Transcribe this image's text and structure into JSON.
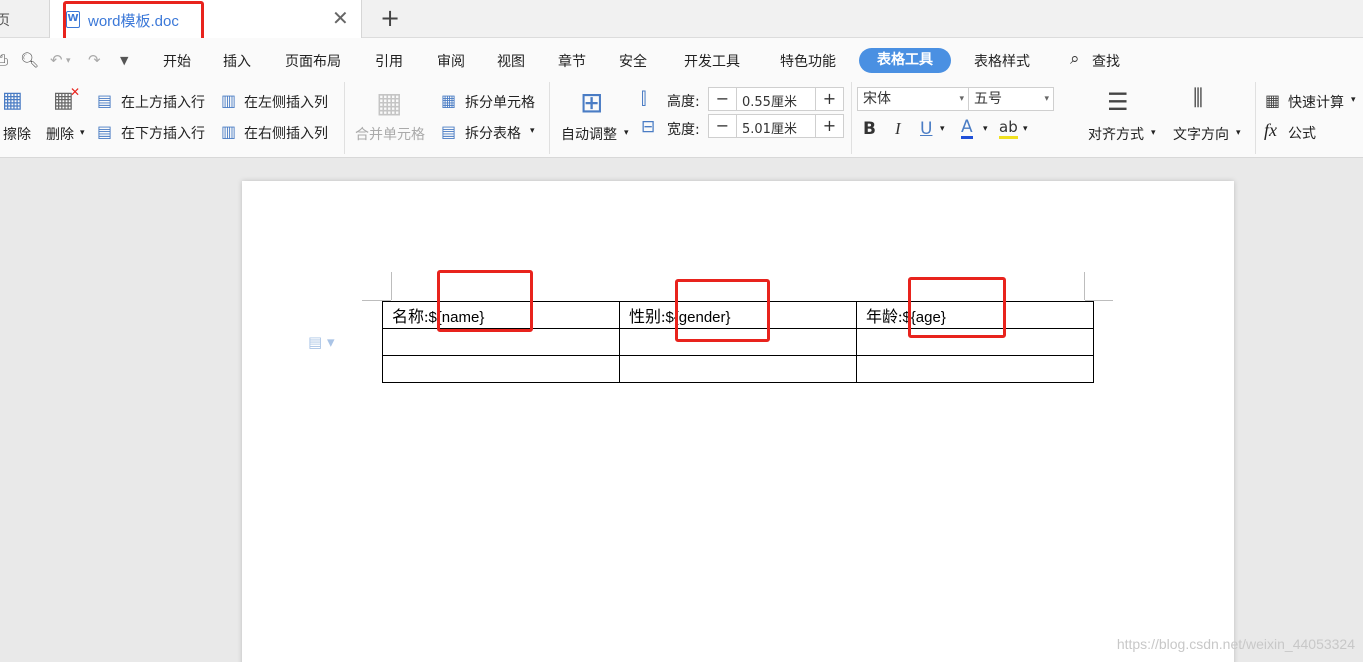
{
  "tabs": {
    "home_partial": "页",
    "active_title": "word模板.doc",
    "doc_icon": "W",
    "close": "✕",
    "new": "+"
  },
  "menu": {
    "items": [
      "开始",
      "插入",
      "页面布局",
      "引用",
      "审阅",
      "视图",
      "章节",
      "安全",
      "开发工具",
      "特色功能",
      "表格工具",
      "表格样式"
    ],
    "active": "表格工具",
    "search": "查找"
  },
  "ribbon": {
    "erase": "擦除",
    "delete": "删除",
    "insert_row_above": "在上方插入行",
    "insert_row_below": "在下方插入行",
    "insert_col_left": "在左侧插入列",
    "insert_col_right": "在右侧插入列",
    "merge_cells": "合并单元格",
    "split_cells": "拆分单元格",
    "split_table": "拆分表格",
    "auto_adjust": "自动调整",
    "height_label": "高度:",
    "height_value": "0.55厘米",
    "width_label": "宽度:",
    "width_value": "5.01厘米",
    "font_name": "宋体",
    "font_size": "五号",
    "bold": "B",
    "italic": "I",
    "underline": "U",
    "font_color": "A",
    "highlight": "ab",
    "align": "对齐方式",
    "text_direction": "文字方向",
    "quick_calc": "快速计算",
    "formula": "公式",
    "formula_icon": "fx"
  },
  "document": {
    "rows": [
      [
        {
          "label": "名称:",
          "tag": "${name}"
        },
        {
          "label": "性别:",
          "tag": "${gender}"
        },
        {
          "label": "年龄:",
          "tag": "${age}"
        }
      ],
      [
        {
          "label": "",
          "tag": ""
        },
        {
          "label": "",
          "tag": ""
        },
        {
          "label": "",
          "tag": ""
        }
      ],
      [
        {
          "label": "",
          "tag": ""
        },
        {
          "label": "",
          "tag": ""
        },
        {
          "label": "",
          "tag": ""
        }
      ]
    ]
  },
  "watermark": "https://blog.csdn.net/weixin_44053324",
  "colors": {
    "accent": "#4a90e2",
    "highlight_box": "#e8231d",
    "tab_text": "#3b78d8"
  },
  "icons": [
    "print-preview-icon",
    "undo-icon",
    "redo-icon",
    "customize-icon",
    "search-icon",
    "paragraph-layout-icon"
  ]
}
